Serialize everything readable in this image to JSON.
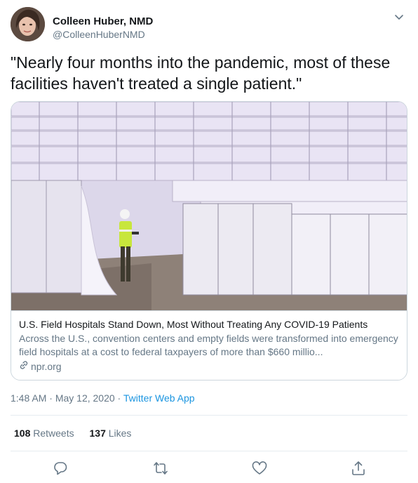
{
  "user": {
    "name": "Colleen Huber, NMD",
    "handle": "@ColleenHuberNMD"
  },
  "tweet": {
    "text": "\"Nearly four months into the pandemic, most of these facilities haven't treated a single patient.\""
  },
  "card": {
    "title": "U.S. Field Hospitals Stand Down, Most Without Treating Any COVID-19 Patients",
    "description": "Across the U.S., convention centers and empty fields were transformed into emergency field hospitals at a cost to federal taxpayers of more than $660 millio...",
    "domain": "npr.org"
  },
  "meta": {
    "time": "1:48 AM",
    "separator1": " · ",
    "date": "May 12, 2020",
    "separator2": " · ",
    "app": "Twitter Web App"
  },
  "stats": {
    "retweets_count": "108",
    "retweets_label": "Retweets",
    "likes_count": "137",
    "likes_label": "Likes"
  },
  "colors": {
    "link": "#1b95e0",
    "secondary_text": "#657786",
    "border": "#ccd6dd"
  },
  "icons": [
    "chevron-down-icon",
    "link-icon",
    "reply-icon",
    "retweet-icon",
    "like-icon",
    "share-icon"
  ]
}
